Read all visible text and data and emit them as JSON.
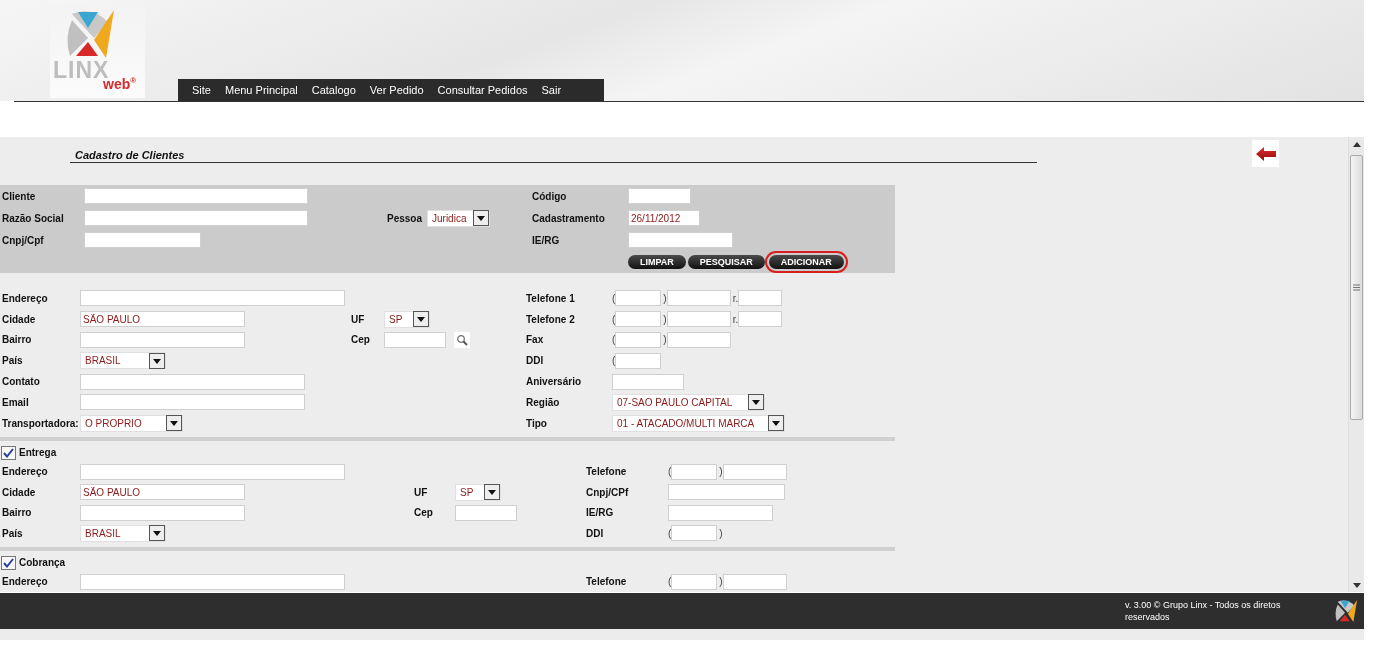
{
  "logo": {
    "word": "LINX",
    "sub": "web",
    "mark": "®"
  },
  "nav": [
    "Site",
    "Menu Principal",
    "Catalogo",
    "Ver Pedido",
    "Consultar Pedidos",
    "Sair"
  ],
  "page_title": "Cadastro de Clientes",
  "sections": [
    {
      "kind": "search",
      "rows": [
        {
          "left": {
            "label": "Cliente",
            "controls": [
              {
                "kind": "text"
              }
            ]
          },
          "right": {
            "label": "Código",
            "controls": [
              {
                "kind": "text"
              }
            ]
          }
        },
        {
          "left": {
            "label": "Razão Social",
            "controls": [
              {
                "kind": "text"
              }
            ]
          },
          "mid": {
            "label": "Pessoa",
            "controls": [
              {
                "kind": "select",
                "value": "Juridica"
              }
            ]
          },
          "right": {
            "label": "Cadastramento",
            "controls": [
              {
                "kind": "text",
                "value": "26/11/2012"
              }
            ]
          }
        },
        {
          "left": {
            "label": "Cnpj/Cpf",
            "controls": [
              {
                "kind": "text"
              }
            ]
          },
          "right": {
            "label": "IE/RG",
            "controls": [
              {
                "kind": "text"
              }
            ]
          }
        }
      ],
      "buttons": [
        {
          "label": "LIMPAR",
          "highlighted": false
        },
        {
          "label": "PESQUISAR",
          "highlighted": false
        },
        {
          "label": "ADICIONAR",
          "highlighted": true
        }
      ]
    },
    {
      "kind": "main",
      "rows": [
        {
          "left": {
            "label": "Endereço",
            "controls": [
              {
                "kind": "text"
              }
            ]
          },
          "right": {
            "label": "Telefone 1",
            "controls": [
              {
                "kind": "sep",
                "text": "("
              },
              {
                "kind": "text"
              },
              {
                "kind": "sep",
                "text": ")"
              },
              {
                "kind": "text"
              },
              {
                "kind": "sep",
                "text": "r."
              },
              {
                "kind": "text"
              }
            ]
          }
        },
        {
          "left": {
            "label": "Cidade",
            "controls": [
              {
                "kind": "text",
                "value": "SÃO PAULO"
              }
            ]
          },
          "mid": {
            "label": "UF",
            "controls": [
              {
                "kind": "select",
                "value": "SP"
              }
            ]
          },
          "right": {
            "label": "Telefone 2",
            "controls": [
              {
                "kind": "sep",
                "text": "("
              },
              {
                "kind": "text"
              },
              {
                "kind": "sep",
                "text": ")"
              },
              {
                "kind": "text"
              },
              {
                "kind": "sep",
                "text": "r."
              },
              {
                "kind": "text"
              }
            ]
          }
        },
        {
          "left": {
            "label": "Bairro",
            "controls": [
              {
                "kind": "text"
              }
            ]
          },
          "mid": {
            "label": "Cep",
            "controls": [
              {
                "kind": "text"
              },
              {
                "kind": "lookup"
              }
            ]
          },
          "right": {
            "label": "Fax",
            "controls": [
              {
                "kind": "sep",
                "text": "("
              },
              {
                "kind": "text"
              },
              {
                "kind": "sep",
                "text": ")"
              },
              {
                "kind": "text"
              }
            ]
          }
        },
        {
          "left": {
            "label": "País",
            "controls": [
              {
                "kind": "select",
                "value": "BRASIL"
              }
            ]
          },
          "right": {
            "label": "DDI",
            "controls": [
              {
                "kind": "sep",
                "text": "("
              },
              {
                "kind": "text"
              }
            ]
          }
        },
        {
          "left": {
            "label": "Contato",
            "controls": [
              {
                "kind": "text"
              }
            ]
          },
          "right": {
            "label": "Aniversário",
            "controls": [
              {
                "kind": "text"
              }
            ]
          }
        },
        {
          "left": {
            "label": "Email",
            "controls": [
              {
                "kind": "text"
              }
            ]
          },
          "right": {
            "label": "Região",
            "controls": [
              {
                "kind": "select",
                "value": "07-SAO PAULO CAPITAL"
              }
            ]
          }
        },
        {
          "left": {
            "label": "Transportadora:",
            "controls": [
              {
                "kind": "select",
                "value": "O PROPRIO"
              }
            ]
          },
          "right": {
            "label": "Tipo",
            "controls": [
              {
                "kind": "select",
                "value": "01 - ATACADO/MULTI MARCA"
              }
            ]
          }
        }
      ]
    },
    {
      "kind": "address",
      "checkbox": {
        "label": "Entrega",
        "checked": true
      },
      "rows": [
        {
          "left": {
            "label": "Endereço",
            "controls": [
              {
                "kind": "text"
              }
            ]
          },
          "right": {
            "label": "Telefone",
            "controls": [
              {
                "kind": "sep",
                "text": "("
              },
              {
                "kind": "text"
              },
              {
                "kind": "sep",
                "text": ")"
              },
              {
                "kind": "text"
              }
            ]
          }
        },
        {
          "left": {
            "label": "Cidade",
            "controls": [
              {
                "kind": "text",
                "value": "SÃO PAULO"
              }
            ]
          },
          "mid": {
            "label": "UF",
            "controls": [
              {
                "kind": "select",
                "value": "SP"
              }
            ]
          },
          "right": {
            "label": "Cnpj/CPf",
            "controls": [
              {
                "kind": "text"
              }
            ]
          }
        },
        {
          "left": {
            "label": "Bairro",
            "controls": [
              {
                "kind": "text"
              }
            ]
          },
          "mid": {
            "label": "Cep",
            "controls": [
              {
                "kind": "text"
              }
            ]
          },
          "right": {
            "label": "IE/RG",
            "controls": [
              {
                "kind": "text"
              }
            ]
          }
        },
        {
          "left": {
            "label": "País",
            "controls": [
              {
                "kind": "select",
                "value": "BRASIL"
              }
            ]
          },
          "right": {
            "label": "DDI",
            "controls": [
              {
                "kind": "sep",
                "text": "("
              },
              {
                "kind": "text"
              },
              {
                "kind": "sep",
                "text": ")"
              }
            ]
          }
        }
      ]
    },
    {
      "kind": "address",
      "checkbox": {
        "label": "Cobrança",
        "checked": true
      },
      "rows": [
        {
          "left": {
            "label": "Endereço",
            "controls": [
              {
                "kind": "text"
              }
            ]
          },
          "right": {
            "label": "Telefone",
            "controls": [
              {
                "kind": "sep",
                "text": "("
              },
              {
                "kind": "text"
              },
              {
                "kind": "sep",
                "text": ")"
              },
              {
                "kind": "text"
              }
            ]
          }
        }
      ]
    }
  ],
  "footer": "v. 3.00 © Grupo Linx - Todos os diretos reservados"
}
